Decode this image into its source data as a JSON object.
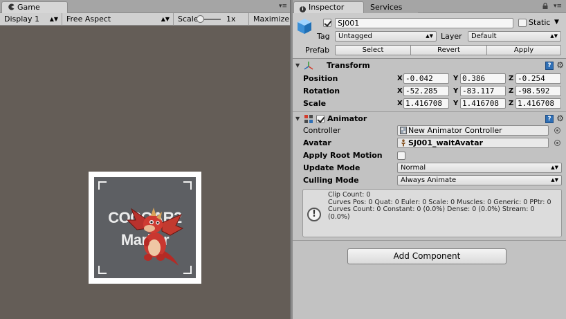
{
  "game": {
    "tab_label": "Game",
    "display": "Display 1",
    "aspect": "Free Aspect",
    "scale_label": "Scale",
    "scale_value": "1x",
    "maximize": "Maximize On Play",
    "marker_line1": "COCOAR2",
    "marker_line2": "Marker"
  },
  "inspector": {
    "tab_label": "Inspector",
    "services_tab": "Services",
    "object_name": "SJ001",
    "static_label": "Static",
    "tag_label": "Tag",
    "tag_value": "Untagged",
    "layer_label": "Layer",
    "layer_value": "Default",
    "prefab_label": "Prefab",
    "prefab_select": "Select",
    "prefab_revert": "Revert",
    "prefab_apply": "Apply"
  },
  "transform": {
    "title": "Transform",
    "rows": [
      {
        "label": "Position",
        "x": "-0.042",
        "y": "0.386",
        "z": "-0.254"
      },
      {
        "label": "Rotation",
        "x": "-52.285",
        "y": "-83.117",
        "z": "-98.592"
      },
      {
        "label": "Scale",
        "x": "1.416708",
        "y": "1.416708",
        "z": "1.416708"
      }
    ],
    "axis_x": "X",
    "axis_y": "Y",
    "axis_z": "Z"
  },
  "animator": {
    "title": "Animator",
    "controller_label": "Controller",
    "controller_value": "New Animator Controller",
    "avatar_label": "Avatar",
    "avatar_value": "SJ001_waitAvatar",
    "root_motion_label": "Apply Root Motion",
    "update_mode_label": "Update Mode",
    "update_mode_value": "Normal",
    "culling_mode_label": "Culling Mode",
    "culling_mode_value": "Always Animate",
    "info_text": "Clip Count: 0\nCurves Pos: 0 Quat: 0 Euler: 0 Scale: 0 Muscles: 0 Generic: 0 PPtr: 0\nCurves Count: 0 Constant: 0 (0.0%) Dense: 0 (0.0%) Stream: 0 (0.0%)"
  },
  "add_component_label": "Add Component",
  "colors": {
    "viewport_bg": "#645d57",
    "inspector_bg": "#c2c2c2",
    "accent_blue": "#2f6fb5"
  }
}
